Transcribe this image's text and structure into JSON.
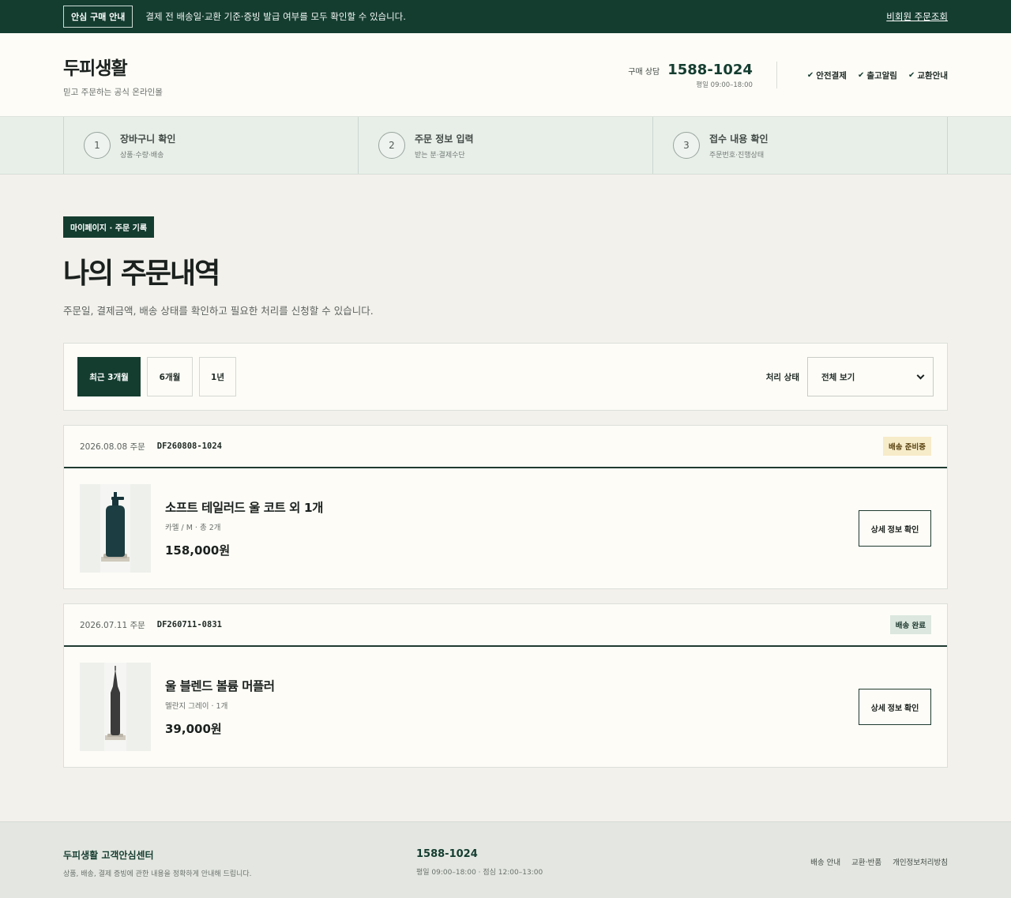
{
  "topbar": {
    "badge": "안심 구매 안내",
    "message": "결제 전 배송일·교환 기준·증빙 발급 여부를 모두 확인할 수 있습니다.",
    "link": "비회원 주문조회"
  },
  "header": {
    "brand_title": "두피생활",
    "brand_sub": "믿고 주문하는 공식 온라인몰",
    "phone_label": "구매 상담",
    "phone_number": "1588-1024",
    "phone_hours": "평일 09:00–18:00",
    "assurances": [
      "안전결제",
      "출고알림",
      "교환안내"
    ]
  },
  "steps": [
    {
      "num": "1",
      "title": "장바구니 확인",
      "sub": "상품·수량·배송"
    },
    {
      "num": "2",
      "title": "주문 정보 입력",
      "sub": "받는 분·결제수단"
    },
    {
      "num": "3",
      "title": "접수 내용 확인",
      "sub": "주문번호·진행상태"
    }
  ],
  "main": {
    "kicker": "마이페이지 · 주문 기록",
    "title": "나의 주문내역",
    "description": "주문일, 결제금액, 배송 상태를 확인하고 필요한 처리를 신청할 수 있습니다."
  },
  "filter": {
    "periods": [
      "최근 3개월",
      "6개월",
      "1년"
    ],
    "active_period": "최근 3개월",
    "status_label": "처리 상태",
    "status_selected": "전체 보기"
  },
  "orders": [
    {
      "date": "2026.08.08 주문",
      "order_no": "DF260808-1024",
      "status": "배송 준비중",
      "item_name": "소프트 테일러드 울 코트 외 1개",
      "item_option": "카멜 / M · 총 2개",
      "price": "158,000원",
      "detail_label": "상세 정보 확인",
      "thumb_color": "#1c3d42"
    },
    {
      "date": "2026.07.11 주문",
      "order_no": "DF260711-0831",
      "status": "배송 완료",
      "item_name": "울 블렌드 볼륨 머플러",
      "item_option": "멜란지 그레이 · 1개",
      "price": "39,000원",
      "detail_label": "상세 정보 확인",
      "thumb_color": "#3a3b3a"
    }
  ],
  "footer": {
    "title": "두피생활 고객안심센터",
    "sub": "상품, 배송, 결제 증빙에 관한 내용을 정확하게 안내해 드립니다.",
    "phone": "1588-1024",
    "hours": "평일 09:00–18:00 · 점심 12:00–13:00",
    "links": [
      "배송 안내",
      "교환·반품",
      "개인정보처리방침"
    ]
  }
}
